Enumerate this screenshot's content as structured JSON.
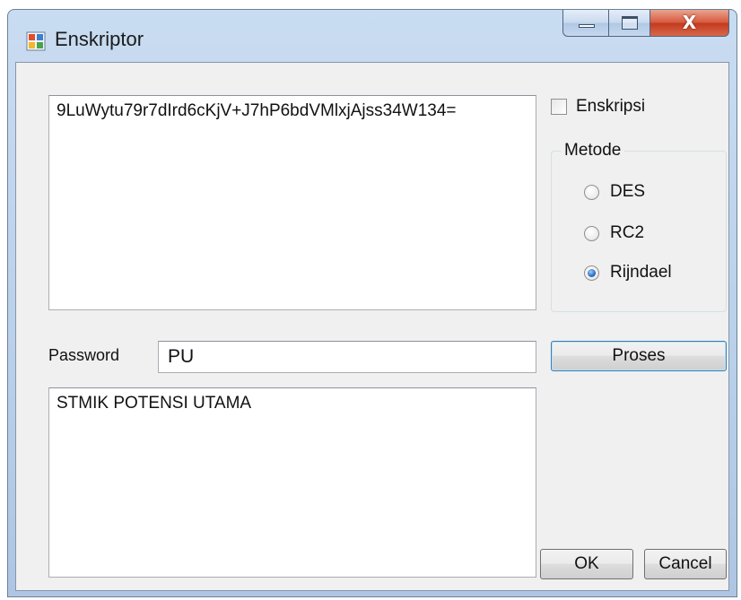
{
  "window": {
    "title": "Enskriptor",
    "close_glyph": "X"
  },
  "input_text": {
    "value": "9LuWytu79r7dIrd6cKjV+J7hP6bdVMlxjAjss34W134="
  },
  "encrypt_checkbox": {
    "label": "Enskripsi",
    "checked": false
  },
  "method_group": {
    "title": "Metode",
    "options": [
      {
        "label": "DES",
        "checked": false
      },
      {
        "label": "RC2",
        "checked": false
      },
      {
        "label": "Rijndael",
        "checked": true
      }
    ]
  },
  "password": {
    "label": "Password",
    "value": "PU"
  },
  "buttons": {
    "process_label": "Proses",
    "ok_label": "OK",
    "cancel_label": "Cancel"
  },
  "output_text": {
    "value": "STMIK POTENSI UTAMA"
  },
  "colors": {
    "title_bar": "#b9d0ea",
    "client_background": "#f0f0f0",
    "close_button": "#c13a1f",
    "radio_selected": "#2a6cc0"
  }
}
